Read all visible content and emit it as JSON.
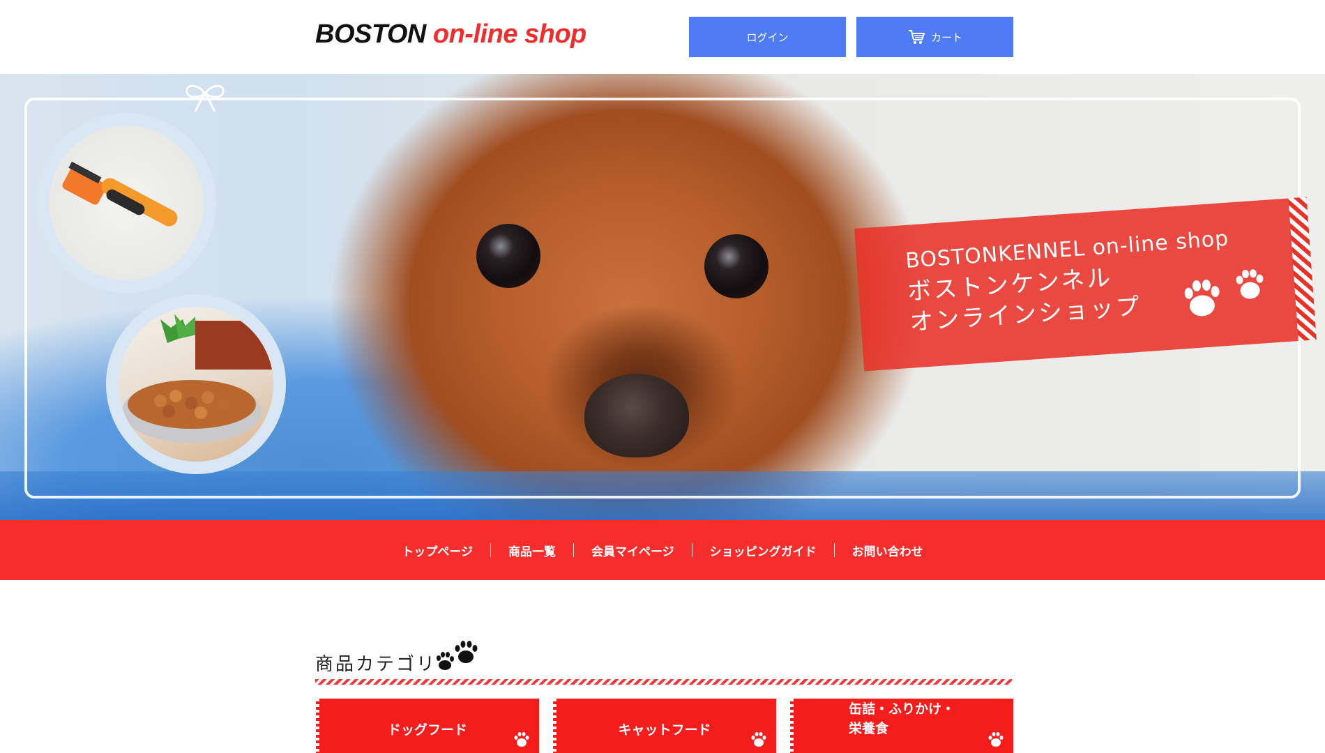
{
  "header": {
    "logo_part1": "BOSTON",
    "logo_part2": "on-line shop",
    "login_label": "ログイン",
    "cart_label": "カート"
  },
  "hero": {
    "banner_en": "BOSTONKENNEL  on-line shop",
    "banner_ja_line1": "ボストンケンネル",
    "banner_ja_line2": "オンラインショップ"
  },
  "nav": {
    "items": [
      {
        "label": "トップページ"
      },
      {
        "label": "商品一覧"
      },
      {
        "label": "会員マイページ"
      },
      {
        "label": "ショッピングガイド"
      },
      {
        "label": "お問い合わせ"
      }
    ]
  },
  "categories": {
    "title": "商品カテゴリ",
    "items": [
      {
        "label": "ドッグフード"
      },
      {
        "label": "キャットフード"
      },
      {
        "label": "缶詰・ふりかけ・",
        "label2": "栄養食"
      }
    ]
  },
  "colors": {
    "accent_red": "#f52d2d",
    "button_blue": "#4d7cf6",
    "card_red": "#f51c1c"
  }
}
